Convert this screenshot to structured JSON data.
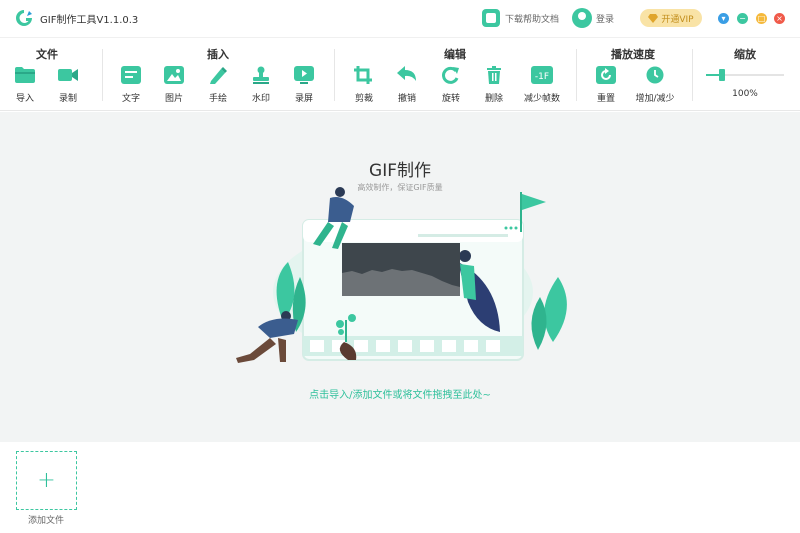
{
  "app": {
    "title": "GIF制作工具V1.1.0.3",
    "logo_icon": "app-logo-icon",
    "accent": "#3cc7a0"
  },
  "titlebar": {
    "help_label": "下载帮助文档",
    "login_label": "登录",
    "vip_label": "开通VIP",
    "window_buttons": [
      "skin-icon",
      "minimize-icon",
      "maximize-icon",
      "close-icon"
    ]
  },
  "toolbar": {
    "groups": {
      "file": "文件",
      "insert": "插入",
      "edit": "编辑",
      "speed": "播放速度",
      "zoom": "缩放"
    },
    "tools": {
      "import": "导入",
      "record": "录制",
      "text": "文字",
      "image": "图片",
      "draw": "手绘",
      "watermark": "水印",
      "screen_record": "录屏",
      "crop": "剪裁",
      "undo": "撤销",
      "rotate": "旋转",
      "delete": "删除",
      "reduce_frames": "减少帧数",
      "reset": "重置",
      "speed_adjust": "增加/减少"
    },
    "reduce_frames_badge": "-1F",
    "zoom_level": "100%",
    "zoom_fraction": 0.2
  },
  "main": {
    "title": "GIF制作",
    "subtitle": "高效制作，保证GIF质量",
    "drop_hint": "点击导入/添加文件或将文件拖拽至此处~"
  },
  "filestrip": {
    "add_symbol": "+",
    "add_label": "添加文件"
  }
}
